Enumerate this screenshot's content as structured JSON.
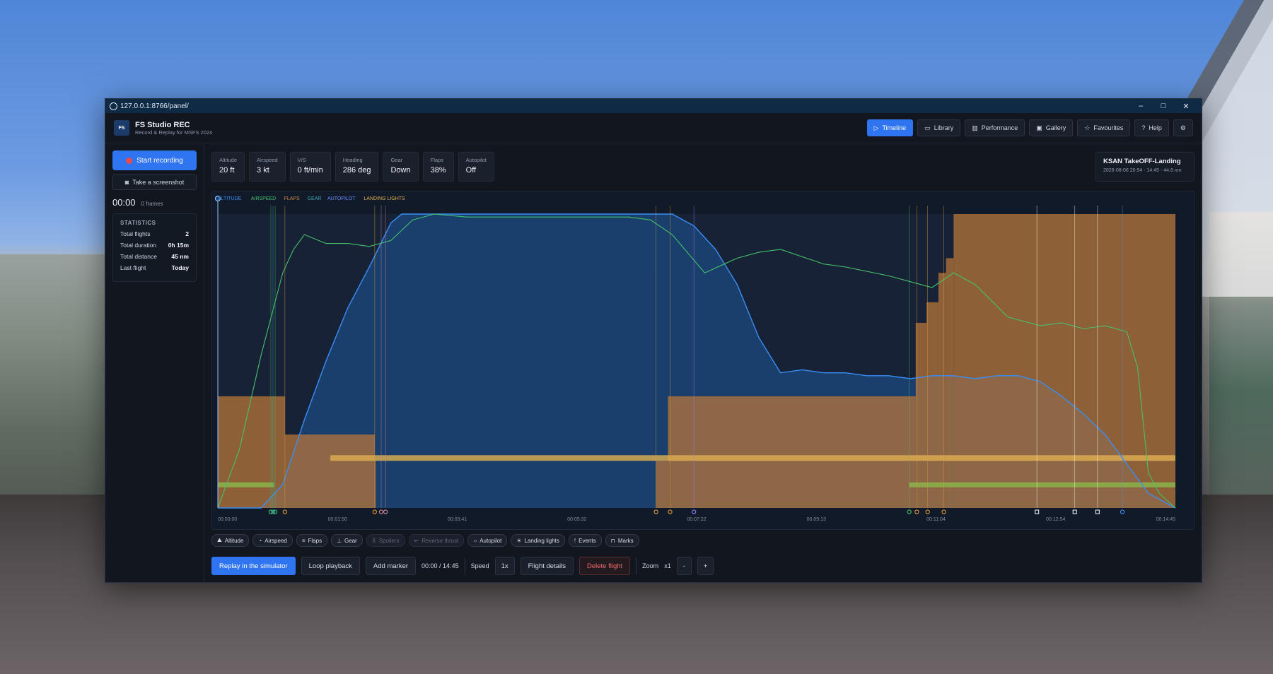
{
  "window": {
    "url": "127.0.0.1:8766/panel/",
    "min": "–",
    "max": "□",
    "close": "✕"
  },
  "brand": {
    "logo": "FS",
    "title": "FS Studio REC",
    "subtitle": "Record & Replay for MSFS 2024"
  },
  "nav": [
    {
      "label": "Timeline",
      "icon": "play-icon",
      "glyph": "▷",
      "active": true
    },
    {
      "label": "Library",
      "icon": "folder-icon",
      "glyph": "▭"
    },
    {
      "label": "Performance",
      "icon": "bar-chart-icon",
      "glyph": "▥"
    },
    {
      "label": "Gallery",
      "icon": "image-icon",
      "glyph": "▣"
    },
    {
      "label": "Favourites",
      "icon": "star-icon",
      "glyph": "☆"
    },
    {
      "label": "Help",
      "icon": "help-icon",
      "glyph": "?"
    }
  ],
  "sidebar": {
    "record_label": "Start recording",
    "screenshot_label": "Take a screenshot",
    "timer": "00:00",
    "frames": "0 frames",
    "stats_title": "STATISTICS",
    "stats": [
      {
        "label": "Total flights",
        "value": "2"
      },
      {
        "label": "Total duration",
        "value": "0h 15m"
      },
      {
        "label": "Total distance",
        "value": "45 nm"
      },
      {
        "label": "Last flight",
        "value": "Today"
      }
    ]
  },
  "readouts": [
    {
      "label": "Altitude",
      "value": "20 ft"
    },
    {
      "label": "Airspeed",
      "value": "3 kt"
    },
    {
      "label": "V/S",
      "value": "0 ft/min"
    },
    {
      "label": "Heading",
      "value": "286 deg"
    },
    {
      "label": "Gear",
      "value": "Down"
    },
    {
      "label": "Flaps",
      "value": "38%"
    },
    {
      "label": "Autopilot",
      "value": "Off"
    }
  ],
  "flight": {
    "name": "KSAN TakeOFF-Landing",
    "meta": "2026-08-06 20:54 - 14:45 - 44.6 nm"
  },
  "colors": {
    "altitude": "#3a8ef6",
    "airspeed": "#45c16a",
    "flaps": "#d08a3a",
    "gear": "#8bb34a",
    "autopilot": "#6b8cff",
    "lights": "#e0b050",
    "accent": "#2f74f0"
  },
  "chart_data": {
    "type": "line",
    "legend": [
      {
        "name": "ALTITUDE",
        "color": "#3a8ef6"
      },
      {
        "name": "AIRSPEED",
        "color": "#45c16a"
      },
      {
        "name": "FLAPS",
        "color": "#d08a3a"
      },
      {
        "name": "GEAR",
        "color": "#3aa7b5"
      },
      {
        "name": "AUTOPILOT",
        "color": "#6b8cff"
      },
      {
        "name": "LANDING LIGHTS",
        "color": "#e0b050"
      }
    ],
    "x_ticks": [
      "00:00:00",
      "00:01:50",
      "00:03:41",
      "00:05:32",
      "00:07:22",
      "00:09:13",
      "00:11:04",
      "00:12:54",
      "00:14:45"
    ],
    "x_range_s": [
      0,
      885
    ],
    "y_range_pct": [
      0,
      100
    ],
    "series": [
      {
        "name": "ALTITUDE",
        "x_s": [
          0,
          40,
          60,
          80,
          100,
          120,
          140,
          160,
          170,
          180,
          200,
          230,
          260,
          300,
          330,
          380,
          400,
          420,
          440,
          460,
          480,
          500,
          520,
          540,
          560,
          580,
          600,
          620,
          640,
          660,
          680,
          700,
          720,
          740,
          760,
          780,
          800,
          820,
          840,
          860,
          885
        ],
        "y_pct": [
          0,
          0,
          8,
          30,
          50,
          68,
          82,
          97,
          100,
          100,
          100,
          100,
          100,
          100,
          100,
          100,
          100,
          100,
          96,
          88,
          76,
          58,
          46,
          47,
          46,
          46,
          45,
          45,
          44,
          45,
          45,
          44,
          45,
          45,
          43,
          38,
          32,
          25,
          15,
          5,
          0
        ]
      },
      {
        "name": "AIRSPEED",
        "x_s": [
          0,
          20,
          40,
          60,
          70,
          80,
          100,
          120,
          140,
          160,
          180,
          200,
          230,
          260,
          300,
          360,
          380,
          400,
          420,
          450,
          480,
          500,
          520,
          560,
          580,
          620,
          640,
          660,
          680,
          700,
          730,
          760,
          780,
          800,
          820,
          840,
          850,
          860,
          870,
          885
        ],
        "y_pct": [
          0,
          20,
          52,
          80,
          88,
          93,
          90,
          90,
          89,
          91,
          98,
          100,
          99,
          99,
          99,
          99,
          99,
          98,
          93,
          80,
          85,
          87,
          88,
          83,
          82,
          79,
          77,
          75,
          80,
          76,
          65,
          62,
          63,
          61,
          62,
          60,
          48,
          12,
          5,
          0
        ]
      },
      {
        "name": "FLAPS",
        "segments_s": [
          [
            0,
            62
          ],
          [
            62,
            145
          ],
          [
            145,
            146
          ],
          [
            146,
            405
          ],
          [
            405,
            416
          ],
          [
            416,
            645
          ],
          [
            645,
            655
          ],
          [
            655,
            666
          ],
          [
            666,
            673
          ],
          [
            673,
            680
          ],
          [
            680,
            885
          ]
        ],
        "y_pct": [
          38,
          25,
          16,
          0,
          16,
          38,
          63,
          70,
          80,
          85,
          100
        ]
      },
      {
        "name": "GEAR",
        "intervals_s": [
          [
            0,
            52
          ],
          [
            639,
            885
          ]
        ]
      },
      {
        "name": "LANDING LIGHTS",
        "intervals_s": [
          [
            104,
            885
          ]
        ]
      },
      {
        "name": "AUTOPILOT",
        "intervals_s": [
          [
            146,
            405
          ]
        ]
      }
    ],
    "markers": [
      {
        "t_s": 49,
        "color": "#45c16a"
      },
      {
        "t_s": 51,
        "color": "#3aa7b5"
      },
      {
        "t_s": 53,
        "color": "#45c16a"
      },
      {
        "t_s": 62,
        "color": "#e09a3a"
      },
      {
        "t_s": 145,
        "color": "#e09a3a"
      },
      {
        "t_s": 151,
        "color": "#d08a9a"
      },
      {
        "t_s": 155,
        "color": "#d08a9a"
      },
      {
        "t_s": 405,
        "color": "#e09a3a"
      },
      {
        "t_s": 418,
        "color": "#e09a3a"
      },
      {
        "t_s": 440,
        "color": "#9a7aff"
      },
      {
        "t_s": 639,
        "color": "#45c16a"
      },
      {
        "t_s": 646,
        "color": "#e09a3a"
      },
      {
        "t_s": 656,
        "color": "#e09a3a"
      },
      {
        "t_s": 671,
        "color": "#e09a3a"
      },
      {
        "t_s": 757,
        "color": "#ffffff"
      },
      {
        "t_s": 792,
        "color": "#ffffff"
      },
      {
        "t_s": 813,
        "color": "#ffffff"
      },
      {
        "t_s": 836,
        "color": "#4a8ef6"
      }
    ]
  },
  "toggles": [
    {
      "label": "Altitude",
      "icon": "altitude-icon",
      "glyph": "⛰",
      "on": true
    },
    {
      "label": "Airspeed",
      "icon": "gauge-icon",
      "glyph": "◔",
      "on": true
    },
    {
      "label": "Flaps",
      "icon": "flaps-icon",
      "glyph": "≡",
      "on": true
    },
    {
      "label": "Gear",
      "icon": "gear-icon",
      "glyph": "⊥",
      "on": true
    },
    {
      "label": "Spoilers",
      "icon": "spoilers-icon",
      "glyph": "⊼",
      "on": false
    },
    {
      "label": "Reverse thrust",
      "icon": "reverse-icon",
      "glyph": "⇤",
      "on": false
    },
    {
      "label": "Autopilot",
      "icon": "autopilot-icon",
      "glyph": "○",
      "on": true
    },
    {
      "label": "Landing lights",
      "icon": "lightbulb-icon",
      "glyph": "☀",
      "on": true
    },
    {
      "label": "Events",
      "icon": "events-icon",
      "glyph": "!",
      "on": true
    },
    {
      "label": "Marks",
      "icon": "bookmark-icon",
      "glyph": "⊓",
      "on": true
    }
  ],
  "controls": {
    "replay": "Replay in the simulator",
    "loop": "Loop playback",
    "add_marker": "Add marker",
    "time": "00:00 / 14:45",
    "speed_label": "Speed",
    "speed_value": "1x",
    "details": "Flight details",
    "delete": "Delete flight",
    "zoom_label": "Zoom",
    "zoom_value": "x1",
    "zoom_out": "-",
    "zoom_in": "+"
  }
}
